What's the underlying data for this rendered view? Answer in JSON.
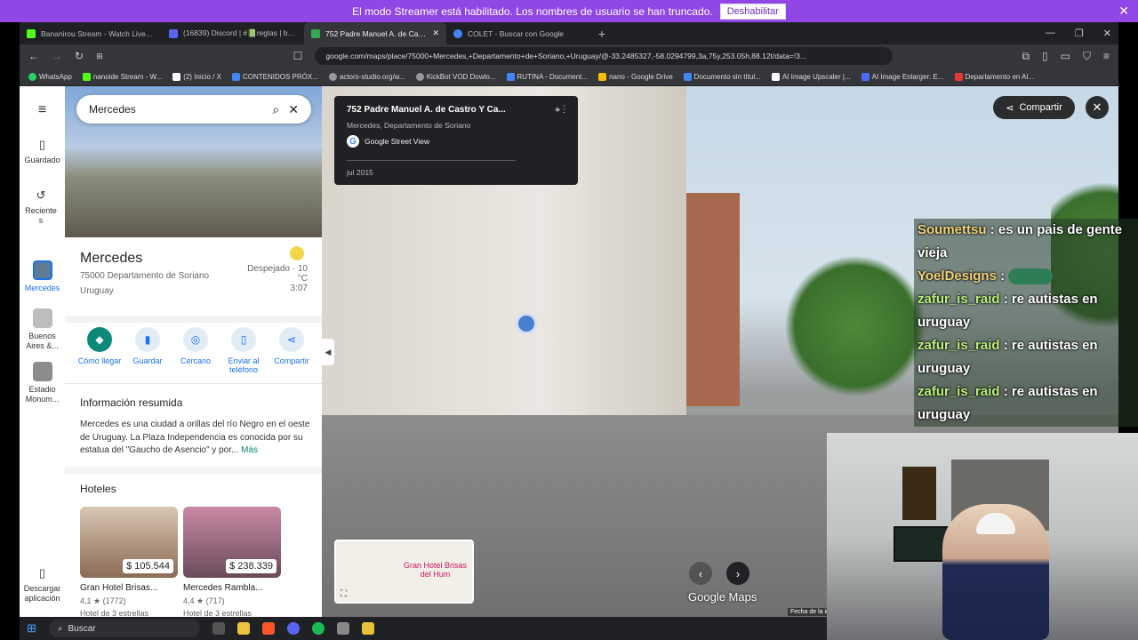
{
  "streamer_banner": {
    "text": "El modo Streamer está habilitado. Los nombres de usuario se han truncado.",
    "button": "Deshabilitar"
  },
  "tabs": [
    {
      "label": "Bananirou Stream - Watch Live on",
      "color": "#53fc18"
    },
    {
      "label": "(16839) Discord | #📗reglas | banani",
      "color": "#5865f2"
    },
    {
      "label": "752 Padre Manuel A. de Castro Y",
      "color": "#34a853",
      "active": true
    },
    {
      "label": "COLET - Buscar con Google",
      "color": "#4285f4"
    }
  ],
  "address": {
    "url": "google.com/maps/place/75000+Mercedes,+Departamento+de+Soriano,+Uruguay/@-33.2485327,-58.0294799,3a,75y,253.05h,88.12t/data=!3..."
  },
  "bookmarks": [
    {
      "label": "WhatsApp",
      "color": "#25d366"
    },
    {
      "label": "nanoide Stream - W...",
      "color": "#53fc18"
    },
    {
      "label": "(2) Inicio / X",
      "color": "#ffffff"
    },
    {
      "label": "CONTENIDOS PRÓX...",
      "color": "#4285f4"
    },
    {
      "label": "actors-studio.org/w...",
      "color": "#999999"
    },
    {
      "label": "KickBot VOD Dowlo...",
      "color": "#999999"
    },
    {
      "label": "RUTINA - Document...",
      "color": "#4285f4"
    },
    {
      "label": "nano - Google Drive",
      "color": "#fbbc04"
    },
    {
      "label": "Documento sin títul...",
      "color": "#4285f4"
    },
    {
      "label": "AI Image Upscaler |...",
      "color": "#ffffff"
    },
    {
      "label": "AI Image Enlarger: E...",
      "color": "#4a6cf7"
    },
    {
      "label": "Departamento en Al...",
      "color": "#e53935"
    }
  ],
  "rail": {
    "saved": "Guardado",
    "recent": "Reciente s",
    "mercedes": "Mercedes",
    "buenos_aires": "Buenos Aires &...",
    "estadio": "Estadio Monum...",
    "download": "Descargar aplicación"
  },
  "search": {
    "value": "Mercedes"
  },
  "place": {
    "title": "Mercedes",
    "address_line1": "75000 Departamento de Soriano",
    "address_line2": "Uruguay",
    "weather_line1": "Despejado · 10",
    "weather_line2": "°C",
    "time": "3:07"
  },
  "actions": [
    "Cómo llegar",
    "Guardar",
    "Cercano",
    "Enviar al teléfono",
    "Compartir"
  ],
  "summary": {
    "heading": "Información resumida",
    "text": "Mercedes es una ciudad a orillas del río Negro en el oeste de Uruguay. La Plaza Independencia es conocida por su estatua del \"Gaucho de Asencio\" y por...",
    "more": "Más"
  },
  "hotels": {
    "heading": "Hoteles",
    "items": [
      {
        "price": "$ 105.544",
        "name": "Gran Hotel Brisas...",
        "rating": "4,1 ★ (1772)",
        "class": "Hotel de 3 estrellas"
      },
      {
        "price": "$ 238.339",
        "name": "Mercedes Rambla...",
        "rating": "4,4 ★ (717)",
        "class": "Hotel de 3 estrellas"
      }
    ]
  },
  "streetview": {
    "title": "752 Padre Manuel A. de Castro Y Ca...",
    "subtitle": "Mercedes, Departamento de Soriano",
    "source": "Google Street View",
    "date": "jul 2015",
    "share": "Compartir",
    "minimap_label": "Gran Hotel Brisas del Hum",
    "logo": "Google Maps",
    "footer": "Fecha de la im"
  },
  "chat": [
    {
      "user": "Soumettsu",
      "text": "es un pais de gente vieja"
    },
    {
      "user": "YoelDesigns",
      "text": ""
    },
    {
      "user": "zafur_is_raid",
      "text": "re autistas en uruguay"
    },
    {
      "user": "zafur_is_raid",
      "text": "re autistas en uruguay"
    },
    {
      "user": "zafur_is_raid",
      "text": "re autistas en uruguay"
    }
  ],
  "taskbar": {
    "search": "Buscar"
  }
}
